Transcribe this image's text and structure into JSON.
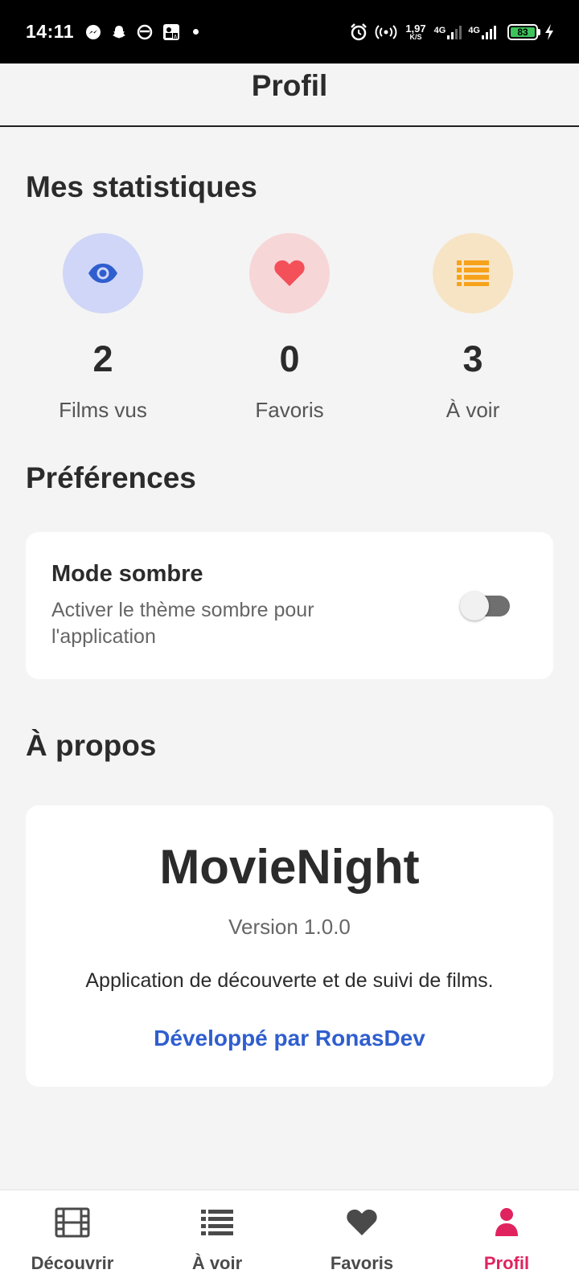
{
  "status_bar": {
    "time": "14:11",
    "speed_value": "1,97",
    "speed_unit": "K/S",
    "net1": "4G",
    "net2": "4G",
    "battery": "83",
    "icons": [
      "messenger-icon",
      "snapchat-icon",
      "ring-icon",
      "app-icon",
      "dot-icon",
      "alarm-icon",
      "hotspot-icon",
      "signal-icon",
      "charging-icon"
    ]
  },
  "header": {
    "title": "Profil"
  },
  "stats_section": {
    "title": "Mes statistiques",
    "items": [
      {
        "value": "2",
        "label": "Films vus",
        "icon": "eye-icon",
        "bg": "#cfd6f7",
        "color": "#2f5ecf"
      },
      {
        "value": "0",
        "label": "Favoris",
        "icon": "heart-icon",
        "bg": "#f7d6d8",
        "color": "#f4505a"
      },
      {
        "value": "3",
        "label": "À voir",
        "icon": "list-icon",
        "bg": "#f7e4c5",
        "color": "#f7a21b"
      }
    ]
  },
  "preferences": {
    "title": "Préférences",
    "dark_mode_title": "Mode sombre",
    "dark_mode_desc": "Activer le thème sombre pour l'application",
    "dark_mode_enabled": false
  },
  "about": {
    "title": "À propos",
    "app_name": "MovieNight",
    "version": "Version 1.0.0",
    "description": "Application de découverte et de suivi de films.",
    "developer": "Développé par RonasDev"
  },
  "bottom_nav": {
    "items": [
      {
        "label": "Découvrir",
        "icon": "film-icon",
        "active": false
      },
      {
        "label": "À voir",
        "icon": "list-icon",
        "active": false
      },
      {
        "label": "Favoris",
        "icon": "heart-icon",
        "active": false
      },
      {
        "label": "Profil",
        "icon": "person-icon",
        "active": true
      }
    ],
    "active_color": "#e0235f",
    "inactive_color": "#4a4a4a"
  }
}
